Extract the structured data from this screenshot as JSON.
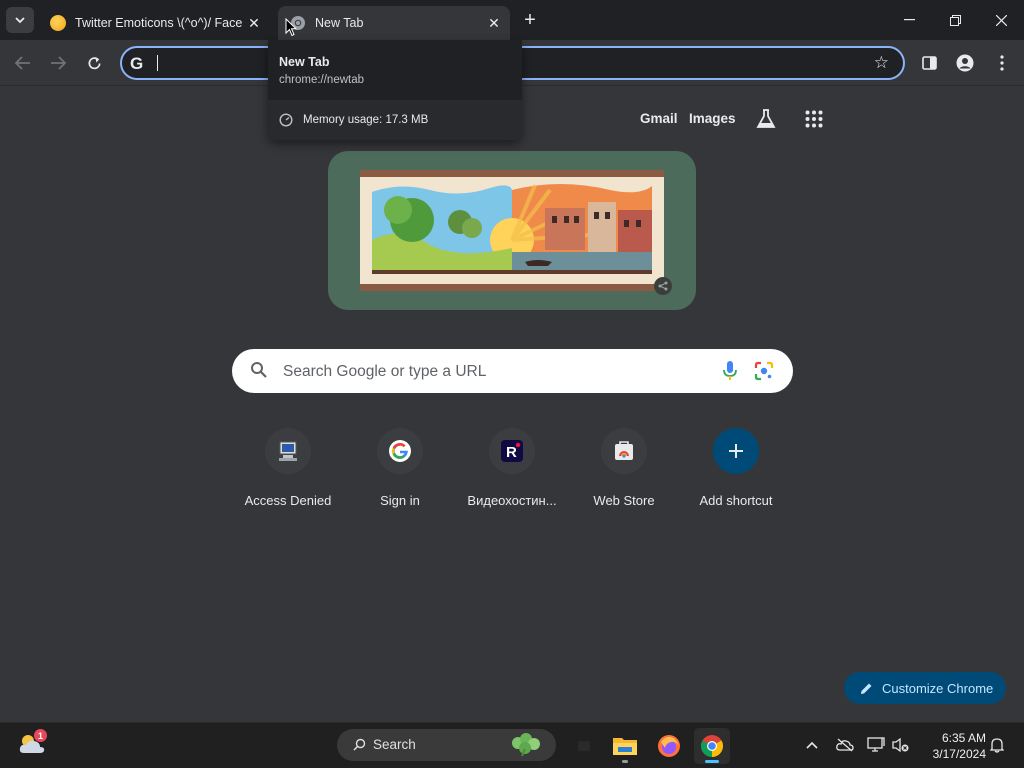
{
  "tabs": [
    {
      "title": "Twitter Emoticons \\(^o^)/ Face",
      "icon": "emoji-face-icon"
    },
    {
      "title": "New Tab",
      "icon": "chrome-icon"
    }
  ],
  "hovercard": {
    "title": "New Tab",
    "url": "chrome://newtab",
    "memory": "Memory usage: 17.3 MB"
  },
  "omnibox": {
    "value": "",
    "search_engine_icon": "google-g-icon"
  },
  "ntp": {
    "gmail": "Gmail",
    "images": "Images",
    "search_placeholder": "Search Google or type a URL",
    "shortcuts": [
      {
        "label": "Access Denied",
        "icon": "computer-icon"
      },
      {
        "label": "Sign in",
        "icon": "google-icon"
      },
      {
        "label": "Видеохостин...",
        "icon": "rutube-icon"
      },
      {
        "label": "Web Store",
        "icon": "web-store-icon"
      },
      {
        "label": "Add shortcut",
        "icon": "plus-icon"
      }
    ],
    "customize": "Customize Chrome"
  },
  "taskbar": {
    "weather_badge": "1",
    "search_label": "Search",
    "time": "6:35 AM",
    "date": "3/17/2024"
  },
  "colors": {
    "background": "#35363a",
    "tabstrip": "#202124",
    "omnibox_focus": "#8ab4f8",
    "doodle_frame": "#4d6b5b",
    "customize_bg": "#004a77"
  }
}
